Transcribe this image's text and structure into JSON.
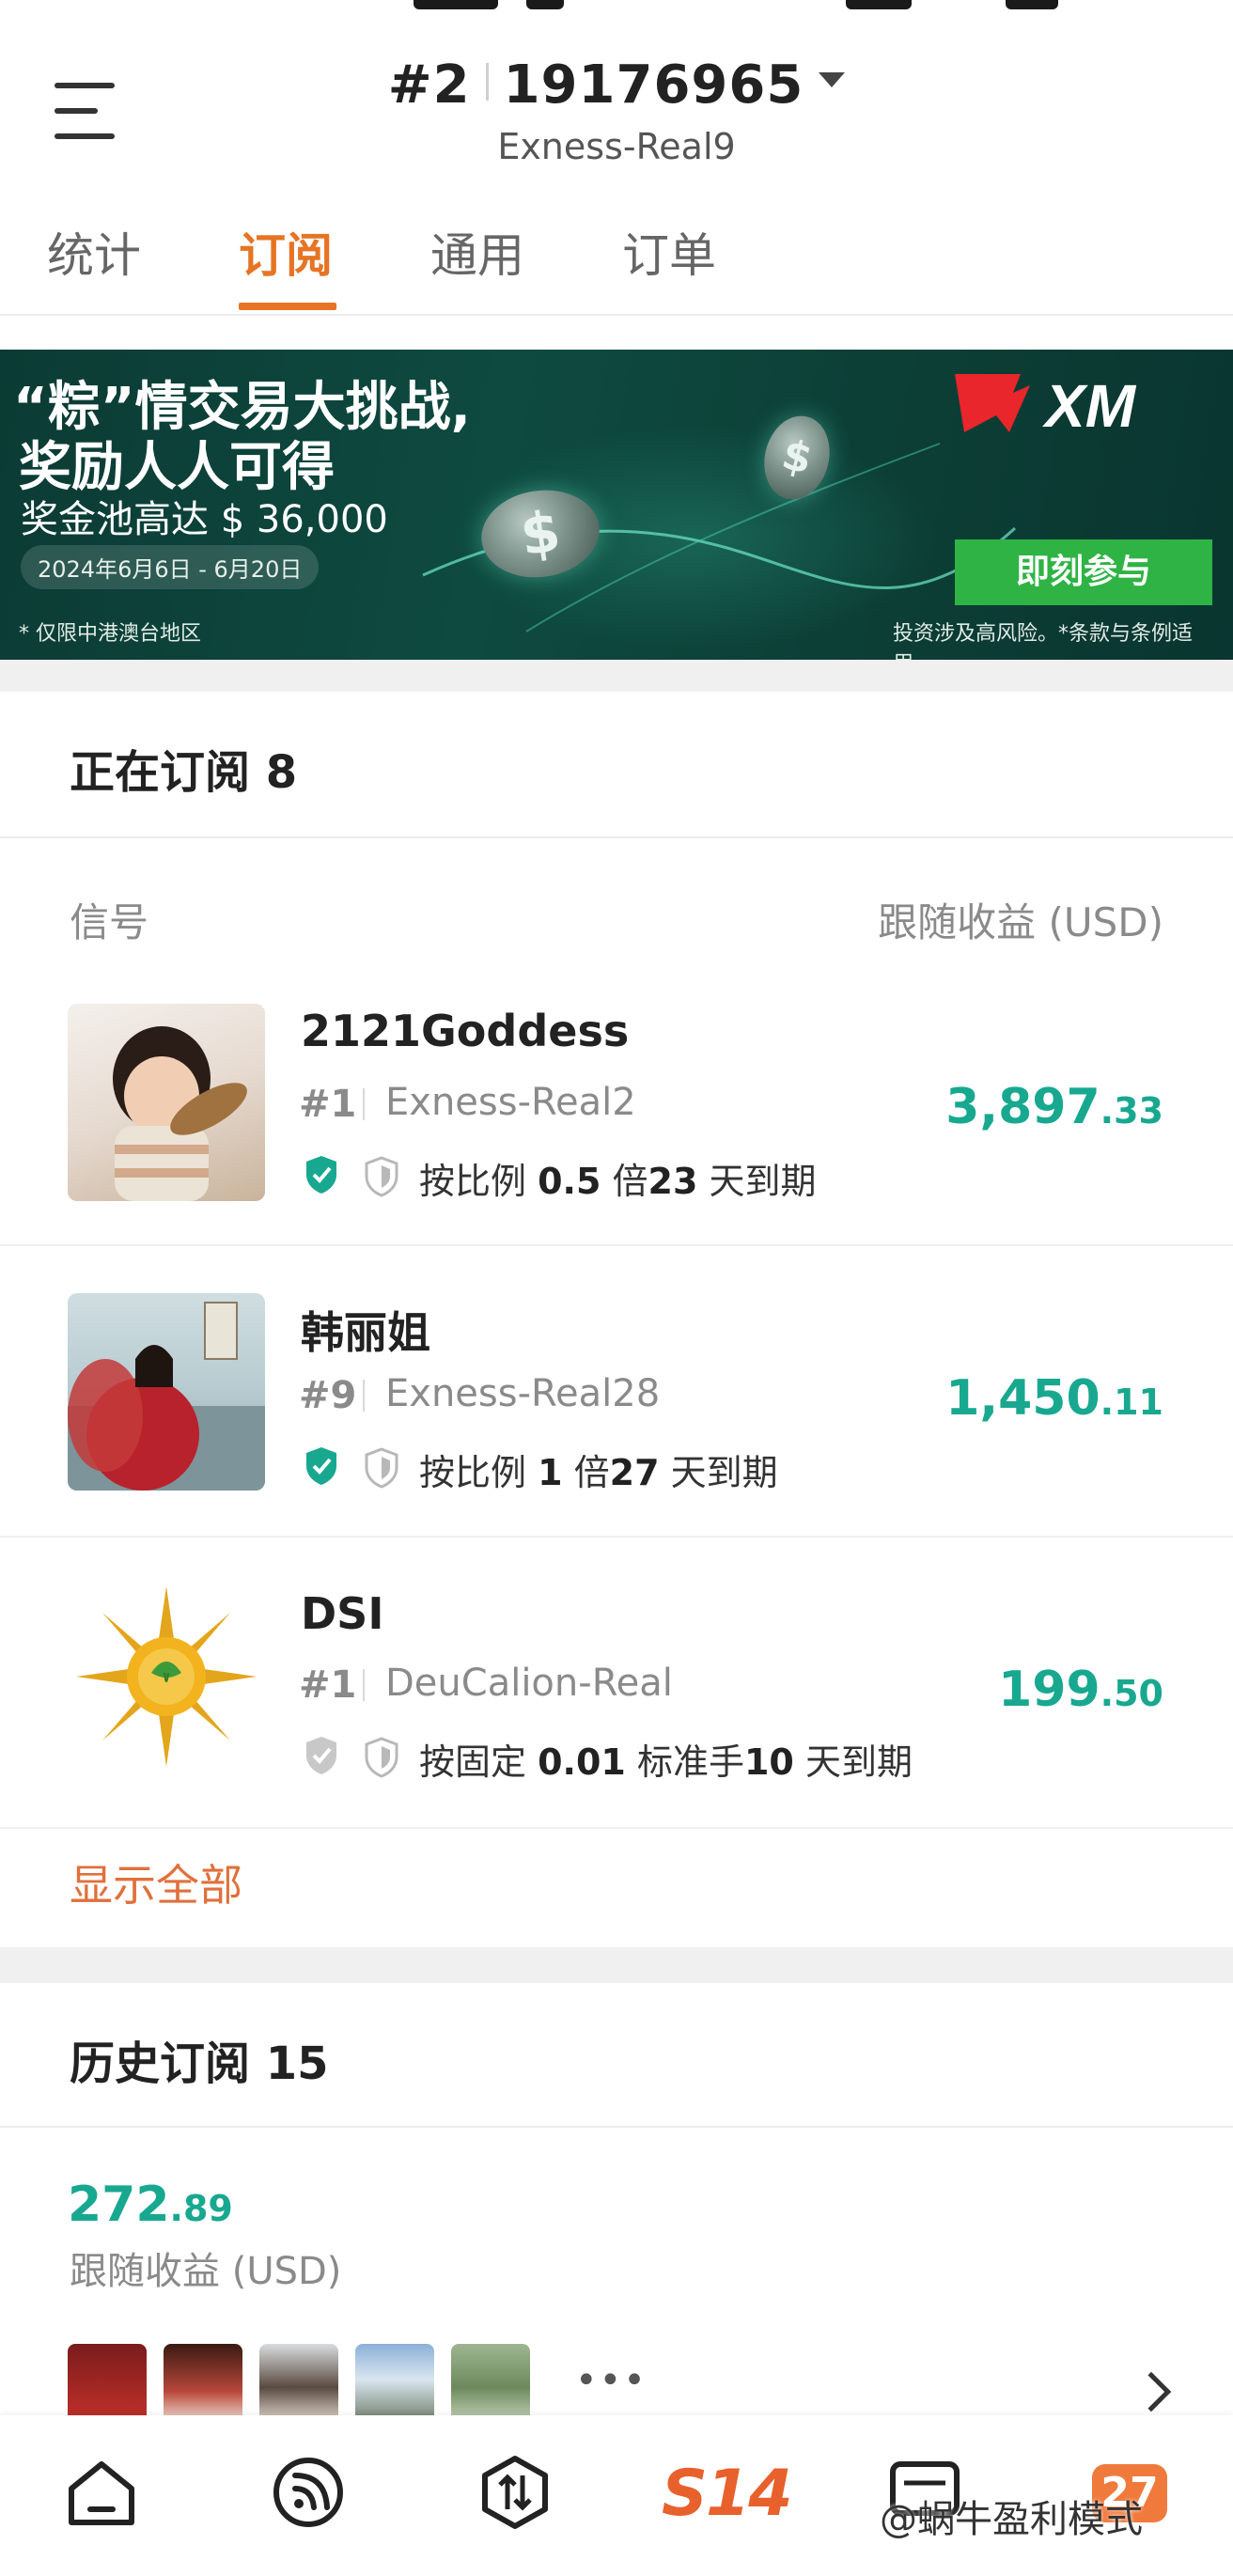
{
  "header": {
    "account_rank": "#2",
    "account_number": "19176965",
    "server": "Exness-Real9"
  },
  "tabs": [
    {
      "label": "统计"
    },
    {
      "label": "订阅"
    },
    {
      "label": "通用"
    },
    {
      "label": "订单"
    }
  ],
  "banner": {
    "title_line1": "“粽”情交易大挑战,",
    "title_line2": "奖励人人可得",
    "prize": "奖金池高达 $ 36,000",
    "date_range": "2024年6月6日 - 6月20日",
    "region_note": "* 仅限中港澳台地区",
    "risk_note": "投资涉及高风险。*条款与条例适用。",
    "cta": "即刻参与",
    "brand": "XM",
    "coin_symbol": "$",
    "colors": {
      "bg": "#0c3f36",
      "cta": "#2fb345",
      "brand_red": "#e8262b"
    }
  },
  "active_subscriptions": {
    "title": "正在订阅 8",
    "col_signal": "信号",
    "col_profit": "跟随收益 (USD)",
    "items": [
      {
        "name": "2121Goddess",
        "rank": "#1",
        "server": "Exness-Real2",
        "profit_int": "3,897",
        "profit_dec": ".33",
        "verified": true,
        "rule_prefix": "按比例",
        "rule_value": "0.5",
        "rule_unit": "倍",
        "days": "23",
        "days_suffix": "天到期",
        "avatar_icon": "child-photo-avatar"
      },
      {
        "name": "韩丽姐",
        "rank": "#9",
        "server": "Exness-Real28",
        "profit_int": "1,450",
        "profit_dec": ".11",
        "verified": true,
        "rule_prefix": "按比例",
        "rule_value": "1",
        "rule_unit": "倍",
        "days": "27",
        "days_suffix": "天到期",
        "avatar_icon": "woman-red-dress-avatar"
      },
      {
        "name": "DSI",
        "rank": "#1",
        "server": "DeuCalion-Real",
        "profit_int": "199",
        "profit_dec": ".50",
        "verified": false,
        "rule_prefix": "按固定",
        "rule_value": "0.01",
        "rule_unit": "标准手",
        "days": "10",
        "days_suffix": "天到期",
        "avatar_icon": "sun-logo-avatar"
      }
    ],
    "show_all": "显示全部"
  },
  "history": {
    "title": "历史订阅 15",
    "profit_int": "272",
    "profit_dec": ".89",
    "profit_label": "跟随收益 (USD)",
    "more": "•••"
  },
  "bottom_nav": {
    "items": [
      "home-icon",
      "signals-icon",
      "trade-icon",
      "s14-logo",
      "messages-icon"
    ],
    "s14_label": "S14",
    "badge": "27",
    "watermark": "@蜗牛盈利模式"
  },
  "colors": {
    "accent": "#e67425",
    "profit": "#18a890",
    "verified": "#18a890"
  }
}
